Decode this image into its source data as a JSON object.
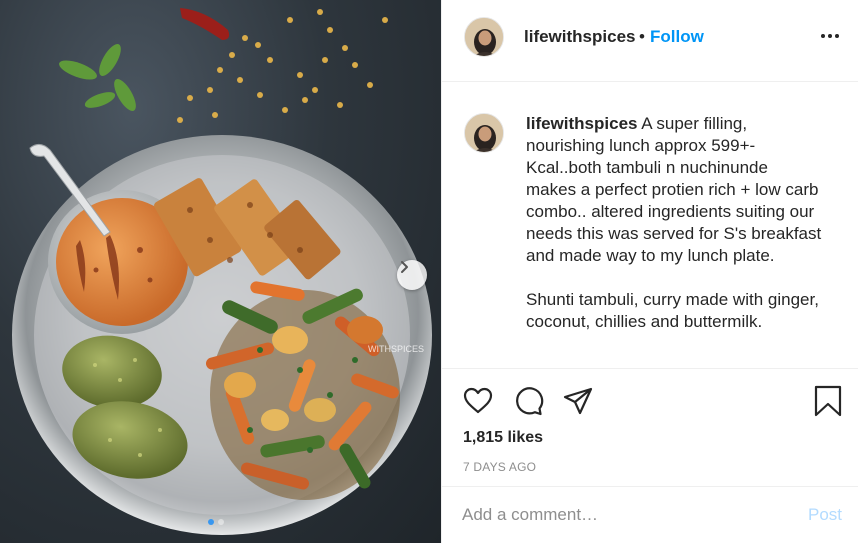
{
  "post": {
    "image_alt": "Steel plate with tambuli curry, paneer slices, steamed greens rolls and roasted vegetables",
    "watermark": "WITHSPICES",
    "carousel_dots": 2,
    "carousel_active": 0
  },
  "header": {
    "username": "lifewithspices",
    "bullet": "•",
    "follow_label": "Follow",
    "more_icon": "more-dots-icon"
  },
  "caption": {
    "username": "lifewithspices",
    "text": " A super filling, nourishing lunch approx 599+- Kcal..both tambuli n nuchinunde makes a perfect protien rich + low carb combo.. altered ingredients suiting our needs this was served for S's breakfast and made way to my lunch plate.\n\nShunti tambuli, curry made with ginger, coconut, chillies and buttermilk."
  },
  "actions": {
    "like_icon": "heart-icon",
    "comment_icon": "comment-icon",
    "share_icon": "share-icon",
    "save_icon": "bookmark-icon",
    "likes_text": "1,815 likes",
    "timestamp": "7 DAYS AGO"
  },
  "comment": {
    "placeholder": "Add a comment…",
    "post_label": "Post"
  },
  "colors": {
    "accent": "#0095f6",
    "post_disabled": "#b3dbff",
    "muted": "#8e8e8e",
    "text": "#262626"
  }
}
